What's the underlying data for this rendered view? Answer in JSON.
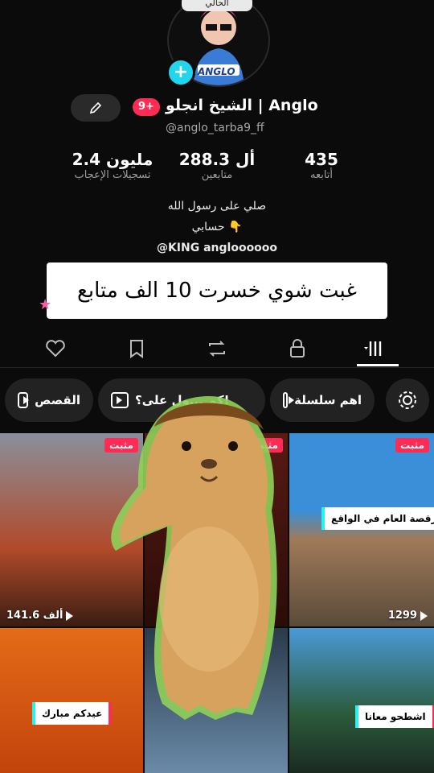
{
  "profile": {
    "top_chip": "الحالي",
    "avatar_text": "ANGLO",
    "name": "الشيخ انجلو | Anglo",
    "badge": "9+",
    "handle": "@anglo_tarba9_ff"
  },
  "stats": [
    {
      "value": "435",
      "label": "أتابعه"
    },
    {
      "value": "288.3 أل",
      "label": "متابعين"
    },
    {
      "value": "2.4 مليون",
      "label": "تسجيلات الإعجاب"
    }
  ],
  "bio": {
    "line1": "صلي على رسول الله",
    "line2": "حسابي 👇",
    "line3": "@KING   angloooooo"
  },
  "overlay_caption": "غبت شوي خسرت 10 الف متابع",
  "tabs": [
    "videos-grid",
    "repost",
    "favorites",
    "liked",
    "private"
  ],
  "playlists": [
    {
      "label": "اهم سلسلة"
    },
    {
      "label": "كم ...ول على؟!"
    },
    {
      "label": "القصص"
    }
  ],
  "videos": [
    {
      "pinned": "مثبت",
      "views": "141.6 ألف"
    },
    {
      "pinned": "مثبت",
      "views": ""
    },
    {
      "pinned": "مثبت",
      "views": "1299",
      "tag": "رقصة العام في الواقع"
    },
    {
      "views": "",
      "tag": "عيدكم مبارك"
    },
    {
      "views": ""
    },
    {
      "views": "",
      "tag": "اشطحو معانا"
    }
  ],
  "colors": {
    "accent": "#fe2c55",
    "cyan": "#25f4ee",
    "bg": "#0b0b0b"
  }
}
